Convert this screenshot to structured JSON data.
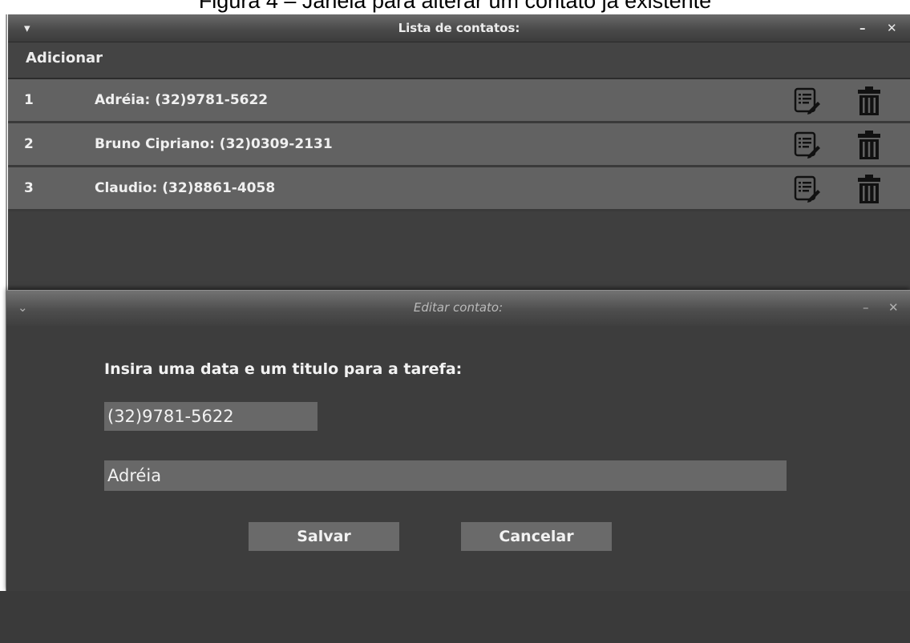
{
  "caption": {
    "text": "Figura 4 – Janela para alterar um contato já existente"
  },
  "main_window": {
    "title": "Lista de contatos:",
    "menu_icon": "chevron-down-icon",
    "minimize_label": "–",
    "close_label": "✕",
    "menu": {
      "add_label": "Adicionar"
    },
    "contacts": [
      {
        "index": "1",
        "text": "Adréia: (32)9781-5622"
      },
      {
        "index": "2",
        "text": "Bruno Cipriano: (32)0309-2131"
      },
      {
        "index": "3",
        "text": "Claudio: (32)8861-4058"
      }
    ]
  },
  "dialog": {
    "title": "Editar contato:",
    "menu_icon": "chevron-down-icon",
    "minimize_label": "–",
    "close_label": "✕",
    "prompt": "Insira uma data e um titulo para a tarefa:",
    "phone_value": "(32)9781-5622",
    "name_value": "Adréia",
    "save_label": "Salvar",
    "cancel_label": "Cancelar"
  },
  "colors": {
    "window_bg": "#3f3f3f",
    "row_bg": "#626262",
    "field_bg": "#686868",
    "text": "#f0f0f0"
  }
}
